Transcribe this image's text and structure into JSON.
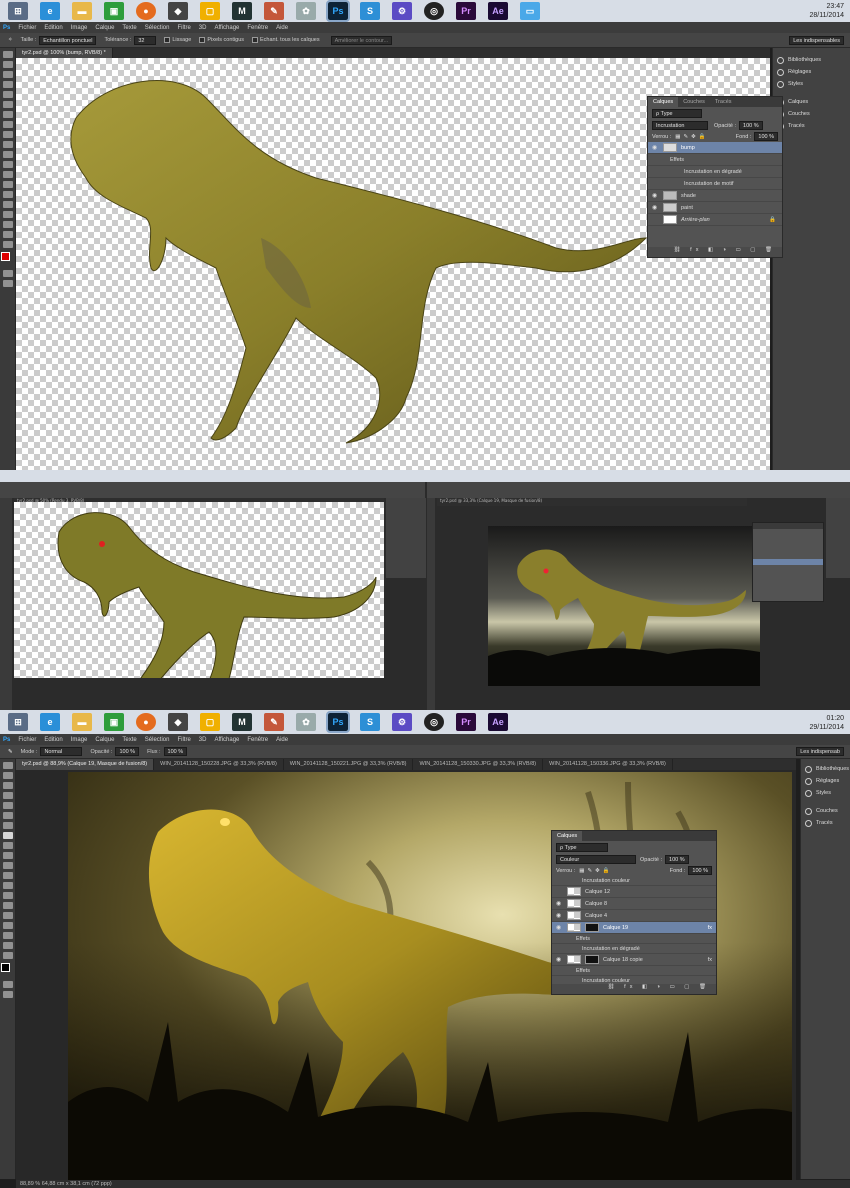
{
  "taskbar_top": {
    "time": "23:47",
    "date": "28/11/2014",
    "icons": [
      "windows-icon",
      "ie-icon",
      "explorer-icon",
      "store-icon",
      "firefox-icon",
      "unity-icon",
      "folder-icon",
      "maya-icon",
      "pencil-icon",
      "zbrush-icon",
      "photoshop-icon",
      "sourcetree-icon",
      "settings-icon",
      "gps-icon",
      "premiere-icon",
      "aftereffects-icon",
      "screen-icon"
    ],
    "labels": {
      "photoshop": "Ps",
      "premiere": "Pr",
      "aftereffects": "Ae",
      "sourcetree": "S",
      "maya": "M"
    }
  },
  "menu": [
    "Fichier",
    "Edition",
    "Image",
    "Calque",
    "Texte",
    "Sélection",
    "Filtre",
    "3D",
    "Affichage",
    "Fenêtre",
    "Aide"
  ],
  "app_logo": "Ps",
  "options_top": {
    "taille_label": "Taille :",
    "taille_value": "Echantillon ponctuel",
    "tolerance_label": "Tolérance :",
    "tolerance_value": "32",
    "lissage": "Lissage",
    "pixels": "Pixels contigus",
    "echant": "Echant. tous les calques",
    "ameliorer": "Améliorer le contour...",
    "workspace": "Les indispensables"
  },
  "doc_tab_top": "tyr2.psd @ 100% (bump, RVB/8) *",
  "layers_top": {
    "tabs": [
      "Calques",
      "Couches",
      "Tracés"
    ],
    "filter": "ρ Type",
    "blend": "Incrustation",
    "opacity_label": "Opacité :",
    "opacity": "100 %",
    "lock_label": "Verrou :",
    "fill_label": "Fond :",
    "fill": "100 %",
    "rows": [
      "bump",
      "Effets",
      "Incrustation en dégradé",
      "Incrustation de motif",
      "shade",
      "paint",
      "Arrière-plan"
    ]
  },
  "dock_top": [
    "Bibliothèques",
    "Réglages",
    "Styles",
    "Calques",
    "Couches",
    "Tracés"
  ],
  "mid_tab_left": "tyr2.psd @ 50% (Rendu 3, RVB/8)",
  "mid_tab_right": "tyr2.psd @ 33,3% (Calque 19, Masque de fusion/8)",
  "taskbar_bottom": {
    "time": "01:20",
    "date": "29/11/2014"
  },
  "options_bottom": {
    "mode_label": "Mode :",
    "mode": "Normal",
    "opacity_label": "Opacité :",
    "opacity": "100 %",
    "flux_label": "Flux :",
    "flux": "100 %",
    "workspace": "Les indispensab"
  },
  "doc_tabs_bottom": [
    "tyr2.psd @ 88,9% (Calque 19, Masque de fusion/8)",
    "WIN_20141128_150228.JPG @ 33,3% (RVB/8)",
    "WIN_20141128_150221.JPG @ 33,3% (RVB/8)",
    "WIN_20141128_150330.JPG @ 33,3% (RVB/8)",
    "WIN_20141128_150336.JPG @ 33,3% (RVB/8)"
  ],
  "layers_bottom": {
    "title": "Calques",
    "filter": "ρ Type",
    "blend": "Couleur",
    "opacity_label": "Opacité :",
    "opacity": "100 %",
    "lock_label": "Verrou :",
    "fill_label": "Fond :",
    "fill": "100 %",
    "rows": [
      "Incrustation couleur",
      "Calque 12",
      "Calque 8",
      "Calque 4",
      "Calque 19",
      "Effets",
      "Incrustation en dégradé",
      "Calque 18 copie",
      "Effets",
      "Incrustation couleur"
    ]
  },
  "dock_bottom": [
    "Bibliothèques",
    "Réglages",
    "Styles",
    "Couches",
    "Tracés"
  ],
  "status_bottom": "88,89 % 64,88 cm x 38,1 cm (72 ppp)",
  "colors": {
    "ps_blue": "#31a8ff",
    "dino": "#8f8a2a",
    "selected_row": "#6d84a8"
  }
}
